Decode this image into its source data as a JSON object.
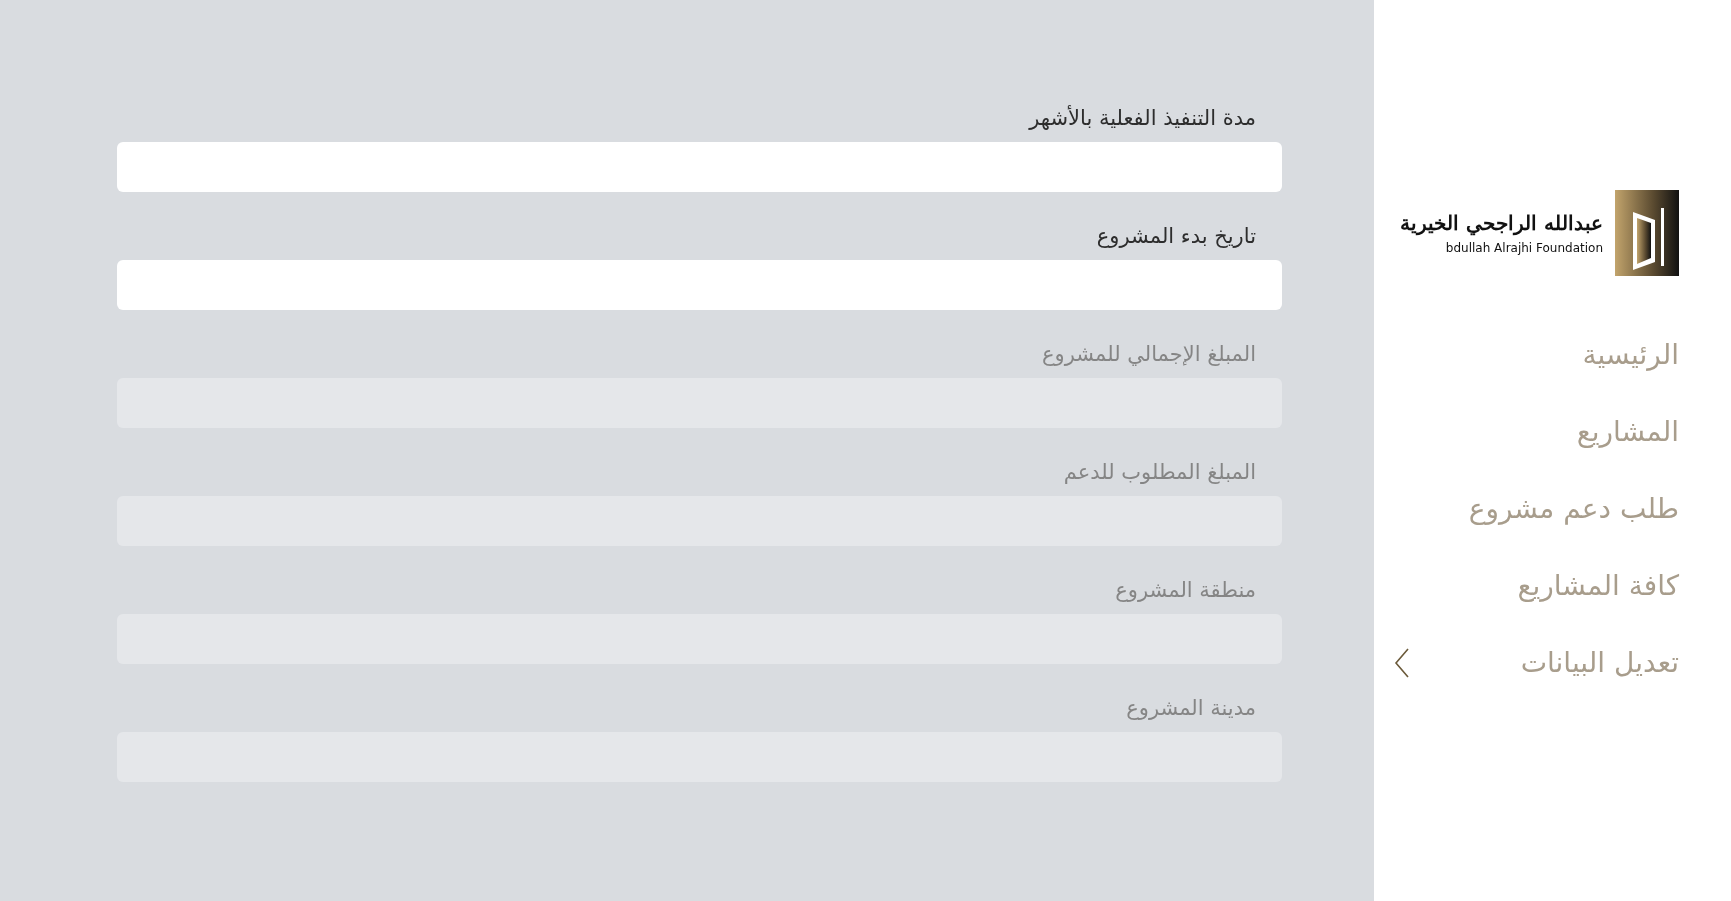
{
  "form": {
    "fields": [
      {
        "label": "مدة التنفيذ الفعلية بالأشهر",
        "disabled": false
      },
      {
        "label": "تاريخ بدء المشروع",
        "disabled": false
      },
      {
        "label": "المبلغ الإجمالي للمشروع",
        "disabled": true
      },
      {
        "label": "المبلغ المطلوب للدعم",
        "disabled": true
      },
      {
        "label": "منطقة المشروع",
        "disabled": true
      },
      {
        "label": "مدينة المشروع",
        "disabled": true
      }
    ]
  },
  "sidebar": {
    "logo": {
      "arabic": "عبدالله الراجحي الخيرية",
      "english": "bdullah Alrajhi Foundation"
    },
    "items": [
      {
        "label": "الرئيسية",
        "has_submenu": false
      },
      {
        "label": "المشاريع",
        "has_submenu": false
      },
      {
        "label": "طلب دعم مشروع",
        "has_submenu": false
      },
      {
        "label": "كافة المشاريع",
        "has_submenu": false
      },
      {
        "label": "تعديل البيانات",
        "has_submenu": true
      }
    ]
  }
}
